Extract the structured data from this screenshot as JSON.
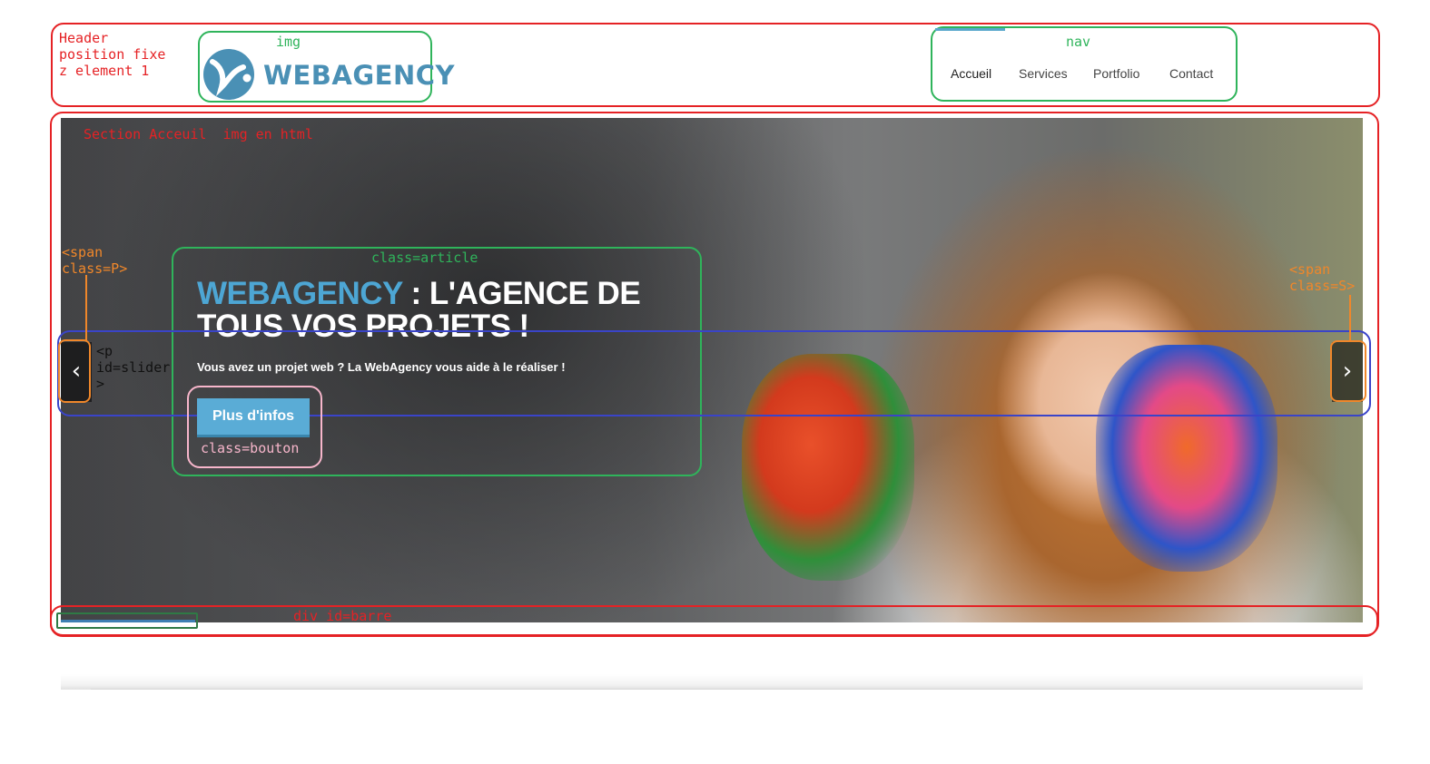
{
  "colors": {
    "annotation_red": "#e52225",
    "annotation_green": "#2fb45b",
    "annotation_blue": "#3a44c9",
    "annotation_orange": "#f0872a",
    "annotation_pink": "#f7b6cb",
    "brand_blue": "#4a90b5",
    "button_blue": "#5aacd6",
    "nav_accent": "#58a7cc"
  },
  "annotations": {
    "header": "Header\nposition fixe\nz element 1",
    "img": "img",
    "nav": "nav",
    "section": "Section Acceuil  img en html",
    "article": "class=article",
    "span_p": "<span\nclass=P>",
    "span_s": "<span\nclass=S>",
    "slider": "<p\nid=slider\n>",
    "bouton": "class=bouton",
    "barre": "div id=barre"
  },
  "header": {
    "logo_text": "WEBAGENCY",
    "logo_icon": "webagency-logo-icon"
  },
  "nav": {
    "items": [
      "Accueil",
      "Services",
      "Portfolio",
      "Contact"
    ]
  },
  "hero": {
    "title_accent": "WEBAGENCY",
    "title_rest": " : L'AGENCE DE TOUS VOS PROJETS !",
    "subtitle": "Vous avez un projet web ? La WebAgency vous aide à le réaliser !",
    "button_label": "Plus d'infos",
    "prev_icon": "chevron-left-icon",
    "prev_glyph": "‹",
    "next_icon": "chevron-right-icon",
    "next_glyph": "›"
  }
}
